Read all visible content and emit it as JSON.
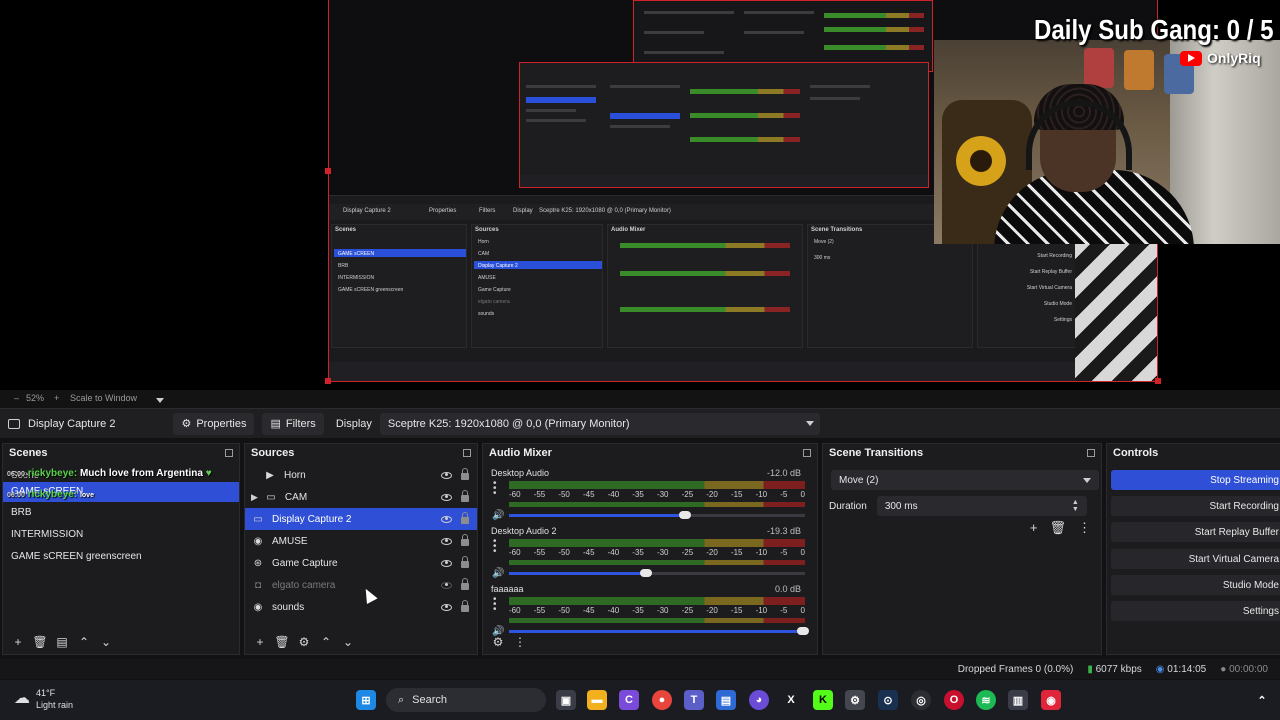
{
  "overlay": {
    "title": "Daily Sub Gang:  0 / 5",
    "channel": "OnlyRiq"
  },
  "preview_bar": {
    "zoom": "52%",
    "scale_mode": "Scale to Window"
  },
  "source_toolbar": {
    "source_name": "Display Capture 2",
    "properties_label": "Properties",
    "filters_label": "Filters",
    "display_label": "Display",
    "display_value": "Sceptre K25: 1920x1080 @ 0,0 (Primary Monitor)"
  },
  "scenes": {
    "title": "Scenes",
    "chat": [
      {
        "time": "06:00",
        "user": "rickybeye:",
        "message": "Much love from Argentina"
      },
      {
        "time": "06:00",
        "user": "rickybeye:",
        "message": "love"
      }
    ],
    "chat_scene_word": "Scene",
    "items": [
      "GAME sCREEN",
      "BRB",
      "INTERMISSION",
      "GAME sCREEN greenscreen"
    ],
    "selected": "GAME sCREEN"
  },
  "sources": {
    "title": "Sources",
    "items": [
      {
        "name": "Horn",
        "icon": "play-icon"
      },
      {
        "name": "CAM",
        "icon": "folder-icon"
      },
      {
        "name": "Display Capture 2",
        "icon": "monitor-icon"
      },
      {
        "name": "AMUSE",
        "icon": "globe-icon"
      },
      {
        "name": "Game Capture",
        "icon": "gamepad-icon"
      },
      {
        "name": "elgato camera",
        "icon": "camera-icon"
      },
      {
        "name": "sounds",
        "icon": "globe-icon"
      }
    ]
  },
  "mixer": {
    "title": "Audio Mixer",
    "ticks": [
      "-60",
      "-55",
      "-50",
      "-45",
      "-40",
      "-35",
      "-30",
      "-25",
      "-20",
      "-15",
      "-10",
      "-5",
      "0"
    ],
    "channels": [
      {
        "name": "Desktop Audio",
        "db": "-12.0 dB",
        "volume": 0.6
      },
      {
        "name": "Desktop Audio 2",
        "db": "-19.3 dB",
        "volume": 0.47
      },
      {
        "name": "faaaaaa",
        "db": "0.0 dB",
        "volume": 1.0
      }
    ]
  },
  "transitions": {
    "title": "Scene Transitions",
    "selected": "Move (2)",
    "duration_label": "Duration",
    "duration_value": "300 ms"
  },
  "controls": {
    "title": "Controls",
    "buttons": [
      "Stop Streaming",
      "Start Recording",
      "Start Replay Buffer",
      "Start Virtual Camera",
      "Studio Mode",
      "Settings"
    ]
  },
  "status": {
    "dropped": "Dropped Frames 0 (0.0%)",
    "bitrate": "6077 kbps",
    "stream_time": "01:14:05",
    "rec_time": "00:00:00"
  },
  "taskbar": {
    "temp": "41°F",
    "weather": "Light rain",
    "search": "Search"
  }
}
